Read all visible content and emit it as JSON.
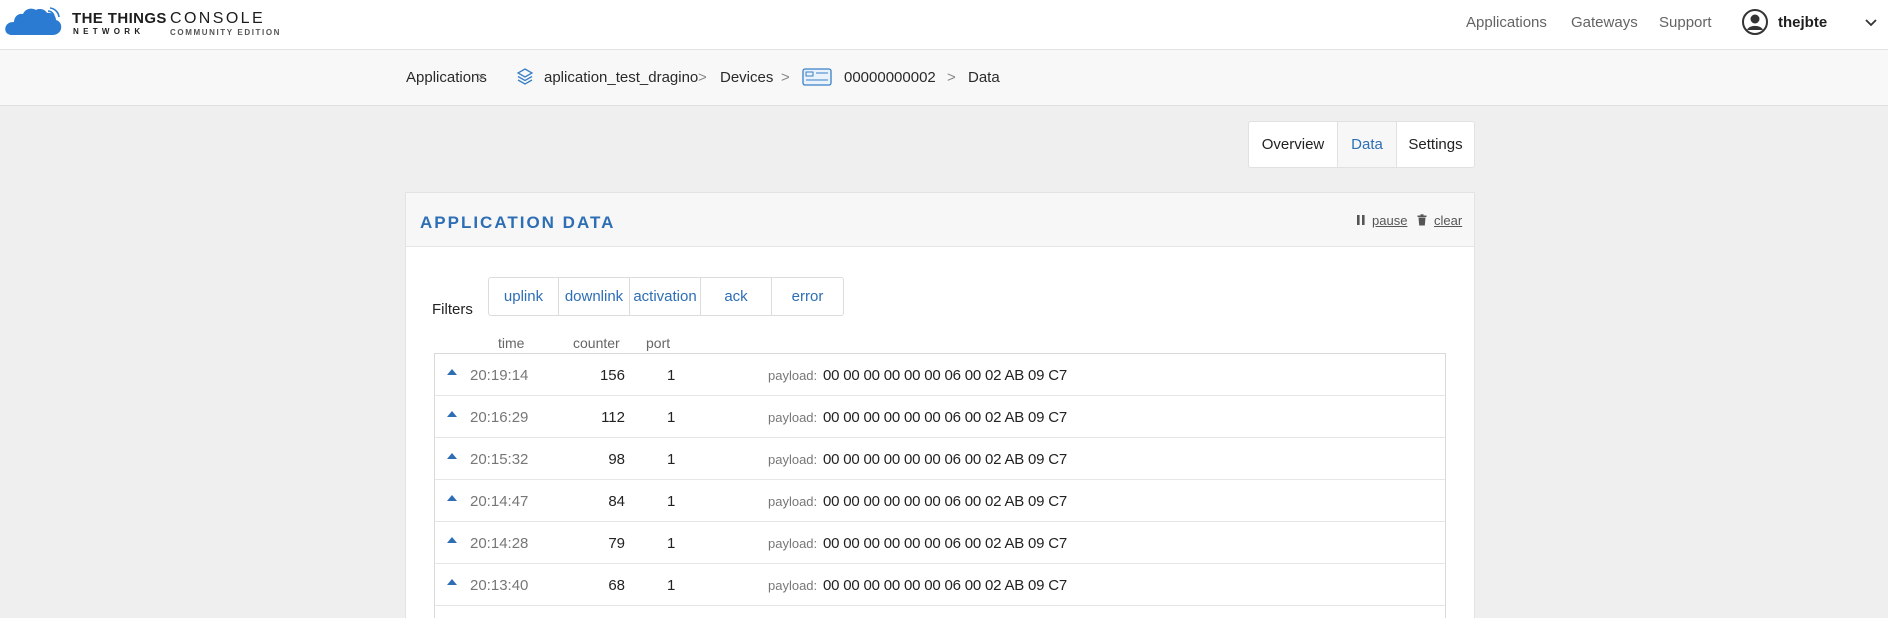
{
  "header": {
    "brand_title": "THE THINGS",
    "brand_sub": "NETWORK",
    "console_title": "CONSOLE",
    "console_sub": "COMMUNITY EDITION",
    "nav": [
      "Applications",
      "Gateways",
      "Support"
    ],
    "username": "thejbte",
    "icons": [
      "cloud-logo",
      "user-avatar-icon",
      "chevron-down-icon"
    ]
  },
  "breadcrumb": {
    "items": [
      "Applications",
      "aplication_test_dragino",
      "Devices",
      "00000000002",
      "Data"
    ],
    "separator": ">",
    "icons": [
      "application-stack-icon",
      "device-icon"
    ]
  },
  "tabs": [
    "Overview",
    "Data",
    "Settings"
  ],
  "active_tab": "Data",
  "panel": {
    "title": "APPLICATION DATA",
    "pause_label": "pause",
    "clear_label": "clear"
  },
  "filters": {
    "label": "Filters",
    "options": [
      "uplink",
      "downlink",
      "activation",
      "ack",
      "error"
    ]
  },
  "columns": {
    "time": "time",
    "counter": "counter",
    "port": "port"
  },
  "payload_label": "payload:",
  "rows": [
    {
      "time": "20:19:14",
      "counter": "156",
      "port": "1",
      "payload": "00 00 00 00 00 00 06 00 02 AB 09 C7"
    },
    {
      "time": "20:16:29",
      "counter": "112",
      "port": "1",
      "payload": "00 00 00 00 00 00 06 00 02 AB 09 C7"
    },
    {
      "time": "20:15:32",
      "counter": "98",
      "port": "1",
      "payload": "00 00 00 00 00 00 06 00 02 AB 09 C7"
    },
    {
      "time": "20:14:47",
      "counter": "84",
      "port": "1",
      "payload": "00 00 00 00 00 00 06 00 02 AB 09 C7"
    },
    {
      "time": "20:14:28",
      "counter": "79",
      "port": "1",
      "payload": "00 00 00 00 00 00 06 00 02 AB 09 C7"
    },
    {
      "time": "20:13:40",
      "counter": "68",
      "port": "1",
      "payload": "00 00 00 00 00 00 06 00 02 AB 09 C7"
    }
  ],
  "colors": {
    "accent": "#2d6eb5",
    "logo": "#2a7bd1"
  }
}
